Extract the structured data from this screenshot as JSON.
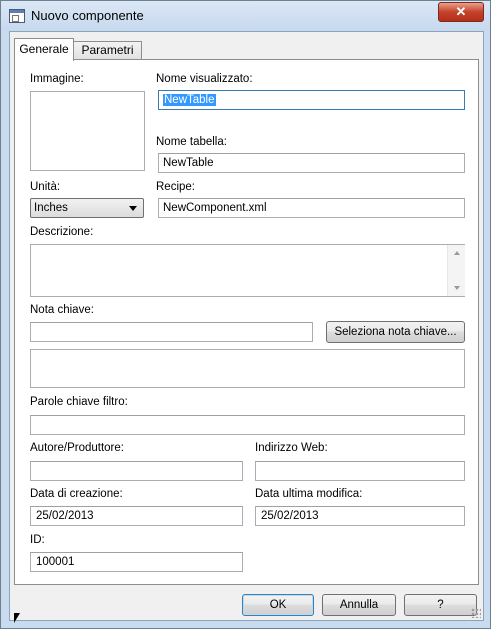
{
  "window": {
    "title": "Nuovo componente",
    "close_label": "✕"
  },
  "tabs": [
    {
      "label": "Generale"
    },
    {
      "label": "Parametri"
    }
  ],
  "form": {
    "image_label": "Immagine:",
    "display_name_label": "Nome visualizzato:",
    "display_name_value": "NewTable",
    "table_name_label": "Nome tabella:",
    "table_name_value": "NewTable",
    "unit_label": "Unità:",
    "unit_value": "Inches",
    "recipe_label": "Recipe:",
    "recipe_value": "NewComponent.xml",
    "description_label": "Descrizione:",
    "description_value": "",
    "key_note_label": "Nota chiave:",
    "key_note_value": "",
    "select_key_note_button": "Seleziona nota chiave...",
    "key_note_detail": "",
    "filter_keywords_label": "Parole chiave filtro:",
    "filter_keywords_value": "",
    "author_label": "Autore/Produttore:",
    "author_value": "",
    "web_label": "Indirizzo Web:",
    "web_value": "",
    "created_label": "Data di creazione:",
    "created_value": "25/02/2013",
    "modified_label": "Data ultima modifica:",
    "modified_value": "25/02/2013",
    "id_label": "ID:",
    "id_value": "100001"
  },
  "buttons": {
    "ok": "OK",
    "cancel": "Annulla",
    "help": "?"
  }
}
